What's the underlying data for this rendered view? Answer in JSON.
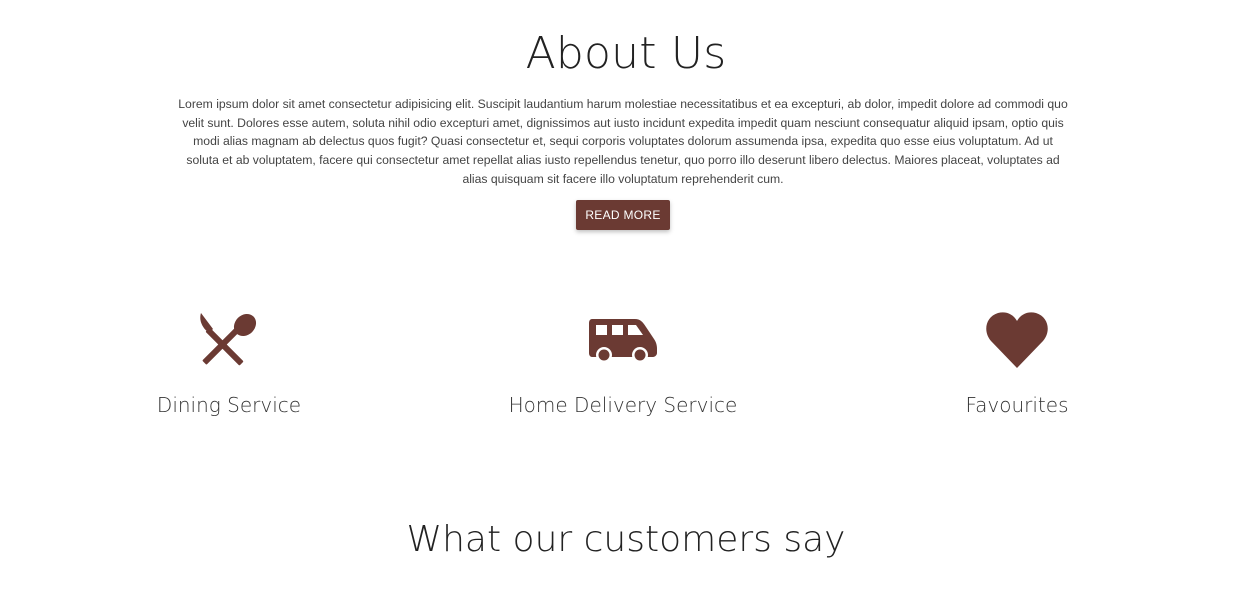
{
  "about": {
    "title": "About Us",
    "text": "Lorem ipsum dolor sit amet consectetur adipisicing elit. Suscipit laudantium harum molestiae necessitatibus et ea excepturi, ab dolor, impedit dolore ad commodi quo velit sunt. Dolores esse autem, soluta nihil odio excepturi amet, dignissimos aut iusto incidunt expedita impedit quam nesciunt consequatur aliquid ipsam, optio quis modi alias magnam ab delectus quos fugit? Quasi consectetur et, sequi corporis voluptates dolorum assumenda ipsa, expedita quo esse eius voluptatum. Ad ut soluta et ab voluptatem, facere qui consectetur amet repellat alias iusto repellendus tenetur, quo porro illo deserunt libero delectus. Maiores placeat, voluptates ad alias quisquam sit facere illo voluptatum reprehenderit cum.",
    "button_label": "READ MORE"
  },
  "services": [
    {
      "label": "Dining Service",
      "icon": "utensils-icon"
    },
    {
      "label": "Home Delivery Service",
      "icon": "van-icon"
    },
    {
      "label": "Favourites",
      "icon": "heart-icon"
    }
  ],
  "testimonials": {
    "title": "What our customers say"
  },
  "colors": {
    "accent": "#6b3a33",
    "text": "#222222",
    "background": "#ffffff"
  }
}
